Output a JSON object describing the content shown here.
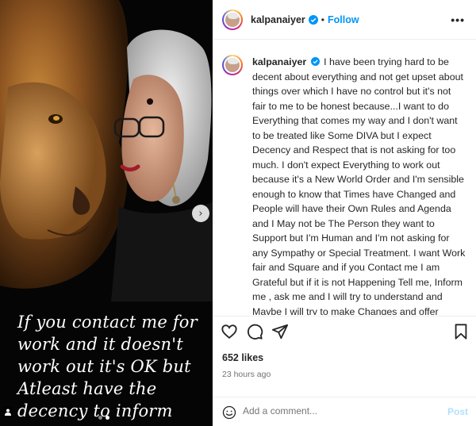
{
  "media": {
    "overlay_text": "If you contact me for work and it doesn't work out it's OK but Atleast have the decency to inform me.",
    "next_icon": "chevron-right-icon",
    "carousel_total": 2,
    "carousel_active": 2
  },
  "header": {
    "username": "kalpanaiyer",
    "separator": "•",
    "follow_label": "Follow",
    "more_icon": "more-horizontal-icon"
  },
  "caption": {
    "username": "kalpanaiyer",
    "text": "I have been trying hard to be decent about everything and not get upset about things over which I have no control but it's not fair to me to be honest because...I want to do Everything that comes my way and I don't want to be treated like Some DIVA but I expect Decency and Respect that is not asking for too much. I don't expect Everything to work out because it's a New World Order and I'm sensible enough to know that Times have Changed and People will have their Own Rules and Agenda and I May not be The Person they want to Support but I'm Human and I'm not asking for any Sympathy or Special Treatment. I want Work fair and Square and if you Contact me I am Grateful but if it is not Happening Tell me, Inform me , ask me and I will try to understand and Maybe I will try to make Changes and offer Alternatives . You Never Know...It will Work for You and Me . Please Don't Presume or Assume Just Ask Me and I'll be Happy and Thankful. I am naming no one Person or Any One in Particular because That is not What This Post Is About. It is about a 70 year old Saying BE FAIR and DECENT and I Think I"
  },
  "stats": {
    "likes": "652 likes",
    "time_ago": "23 hours ago"
  },
  "comment_box": {
    "placeholder": "Add a comment...",
    "post_label": "Post"
  },
  "colors": {
    "accent": "#0095f6",
    "post_disabled": "#b2dffc",
    "verified": "#0095f6"
  }
}
